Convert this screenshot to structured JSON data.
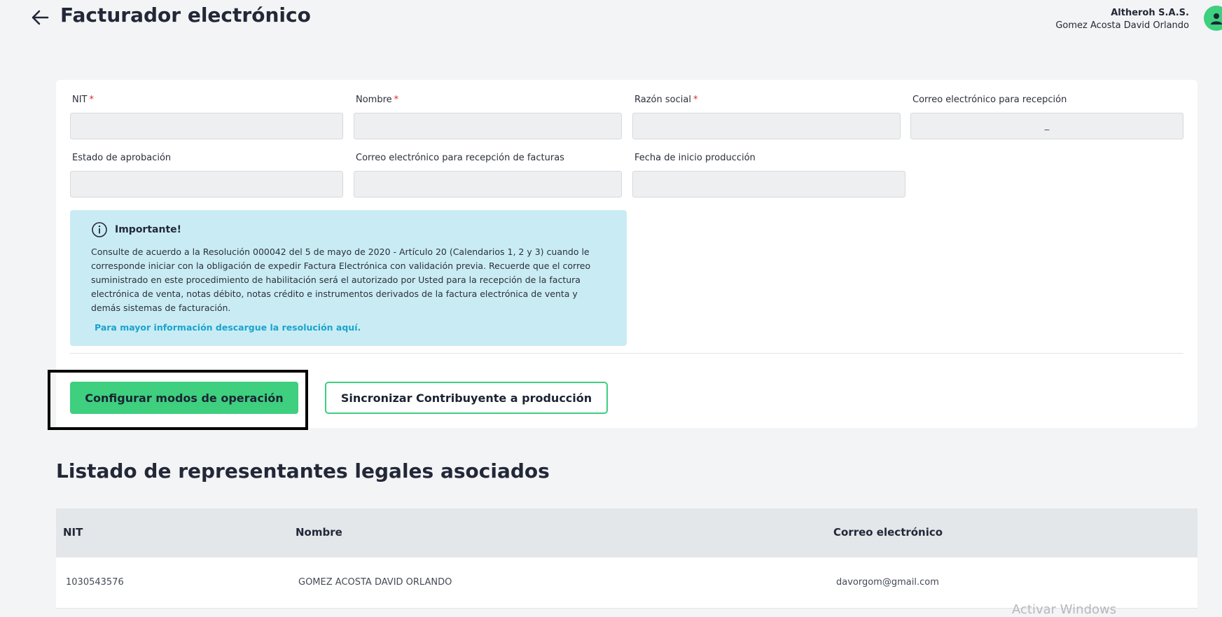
{
  "header": {
    "title": "Facturador electrónico",
    "company": "Altheroh S.A.S.",
    "user_name": "Gomez Acosta David Orlando"
  },
  "form": {
    "fields": [
      {
        "label": "NIT",
        "required": "*",
        "value": ""
      },
      {
        "label": "Nombre",
        "required": "*",
        "value": ""
      },
      {
        "label": "Razón social",
        "required": "*",
        "value": ""
      },
      {
        "label": "Correo electrónico para recepción",
        "required": "",
        "value": "_"
      },
      {
        "label": "Estado de aprobación",
        "required": "",
        "value": ""
      },
      {
        "label": "Correo electrónico para recepción de facturas",
        "required": "",
        "value": ""
      },
      {
        "label": "Fecha de inicio producción",
        "required": "",
        "value": ""
      }
    ]
  },
  "info": {
    "title": "Importante!",
    "body": "Consulte de acuerdo a la Resolución 000042 del 5 de mayo de 2020 - Artículo 20 (Calendarios 1, 2 y 3) cuando le corresponde iniciar con la obligación de expedir Factura Electrónica con validación previa. Recuerde que el correo suministrado en este procedimiento de habilitación será el autorizado por Usted para la recepción de la factura electrónica de venta, notas débito, notas crédito e instrumentos derivados de la factura electrónica de venta y demás sistemas de facturación.",
    "link": "Para mayor información descargue la resolución aquí."
  },
  "actions": {
    "configure": "Configurar modos de operación",
    "sync": "Sincronizar Contribuyente a producción"
  },
  "representatives": {
    "title": "Listado de representantes legales asociados",
    "columns": [
      "NIT",
      "Nombre",
      "Correo electrónico"
    ],
    "rows": [
      {
        "nit": "1030543576",
        "name": "GOMEZ ACOSTA DAVID ORLANDO",
        "email": "davorgom@gmail.com"
      }
    ]
  },
  "watermark": "Activar Windows",
  "colors": {
    "accent": "#3ecf7f",
    "info_bg": "#c9ecf4",
    "link": "#1aa3cf"
  }
}
